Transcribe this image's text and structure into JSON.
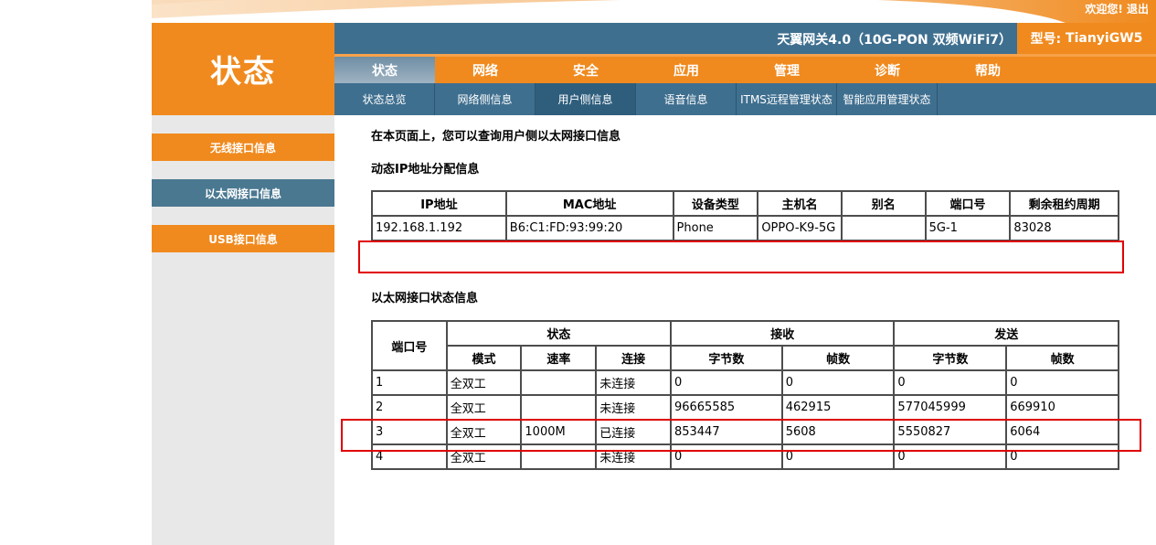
{
  "top": {
    "welcome": "欢迎您!",
    "logout": "退出"
  },
  "page_title": "状态",
  "header": {
    "device_name": "天翼网关4.0（10G-PON 双频WiFi7）",
    "model_label": "型号:",
    "model_value": "TianyiGW5"
  },
  "main_nav": [
    {
      "label": "状态",
      "active": true
    },
    {
      "label": "网络"
    },
    {
      "label": "安全"
    },
    {
      "label": "应用"
    },
    {
      "label": "管理"
    },
    {
      "label": "诊断"
    },
    {
      "label": "帮助"
    }
  ],
  "sub_nav": [
    {
      "label": "状态总览"
    },
    {
      "label": "网络侧信息"
    },
    {
      "label": "用户侧信息",
      "active": true
    },
    {
      "label": "语音信息"
    },
    {
      "label": "ITMS远程管理状态"
    },
    {
      "label": "智能应用管理状态"
    }
  ],
  "sidebar": [
    {
      "label": "无线接口信息"
    },
    {
      "label": "以太网接口信息",
      "active": true
    },
    {
      "label": "USB接口信息"
    }
  ],
  "intro": "在本页面上，您可以查询用户侧以太网接口信息",
  "dhcp": {
    "title": "动态IP地址分配信息",
    "headers": [
      "IP地址",
      "MAC地址",
      "设备类型",
      "主机名",
      "别名",
      "端口号",
      "剩余租约周期"
    ],
    "rows": [
      [
        "192.168.1.192",
        "B6:C1:FD:93:99:20",
        "Phone",
        "OPPO-K9-5G",
        "",
        "5G-1",
        "83028"
      ]
    ]
  },
  "ethernet": {
    "title": "以太网接口状态信息",
    "port_header": "端口号",
    "group_headers": {
      "status": "状态",
      "receive": "接收",
      "send": "发送"
    },
    "sub_headers": [
      "模式",
      "速率",
      "连接",
      "字节数",
      "帧数",
      "字节数",
      "帧数"
    ],
    "rows": [
      [
        "1",
        "全双工",
        "",
        "未连接",
        "0",
        "0",
        "0",
        "0"
      ],
      [
        "2",
        "全双工",
        "",
        "未连接",
        "96665585",
        "462915",
        "577045999",
        "669910"
      ],
      [
        "3",
        "全双工",
        "1000M",
        "已连接",
        "853447",
        "5608",
        "5550827",
        "6064"
      ],
      [
        "4",
        "全双工",
        "",
        "未连接",
        "0",
        "0",
        "0",
        "0"
      ]
    ]
  },
  "colors": {
    "orange": "#f08a1e",
    "blue": "#3f6f8f",
    "highlight_red": "#e00000"
  }
}
